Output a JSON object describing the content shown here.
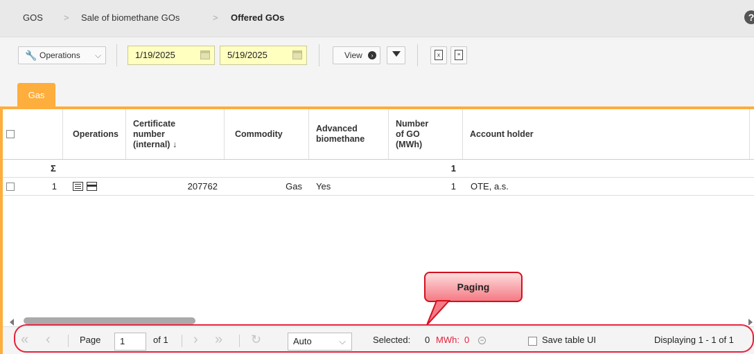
{
  "breadcrumb": {
    "items": [
      "GOS",
      "Sale of biomethane GOs",
      "Offered GOs"
    ],
    "separator": ">"
  },
  "help_label": "?",
  "toolbar": {
    "operations_label": "Operations",
    "date_from": "1/19/2025",
    "date_to": "5/19/2025",
    "view_label": "View"
  },
  "tabs": [
    {
      "label": "Gas"
    }
  ],
  "table": {
    "columns": [
      "Operations",
      "Certificate number (internal)",
      "Commodity",
      "Advanced biomethane",
      "Number of GO (MWh)",
      "Account holder"
    ],
    "sort_indicator": "↓",
    "summary": {
      "symbol": "Σ",
      "number_of_go": "1"
    },
    "rows": [
      {
        "index": "1",
        "certificate": "207762",
        "commodity": "Gas",
        "advanced": "Yes",
        "number_of_go": "1",
        "account_holder": "OTE, a.s."
      }
    ]
  },
  "pager": {
    "page_label": "Page",
    "page_value": "1",
    "of_label": "of 1",
    "page_size": "Auto",
    "selected_label": "Selected:",
    "selected_value": "0",
    "mwh_label": "MWh:",
    "mwh_value": "0",
    "save_ui_label": "Save table UI",
    "displaying": "Displaying 1 - 1 of 1"
  },
  "callout": {
    "label": "Paging"
  },
  "colors": {
    "accent": "#fdae3d",
    "highlight": "#e8203a",
    "date_bg": "#ffffc0"
  }
}
